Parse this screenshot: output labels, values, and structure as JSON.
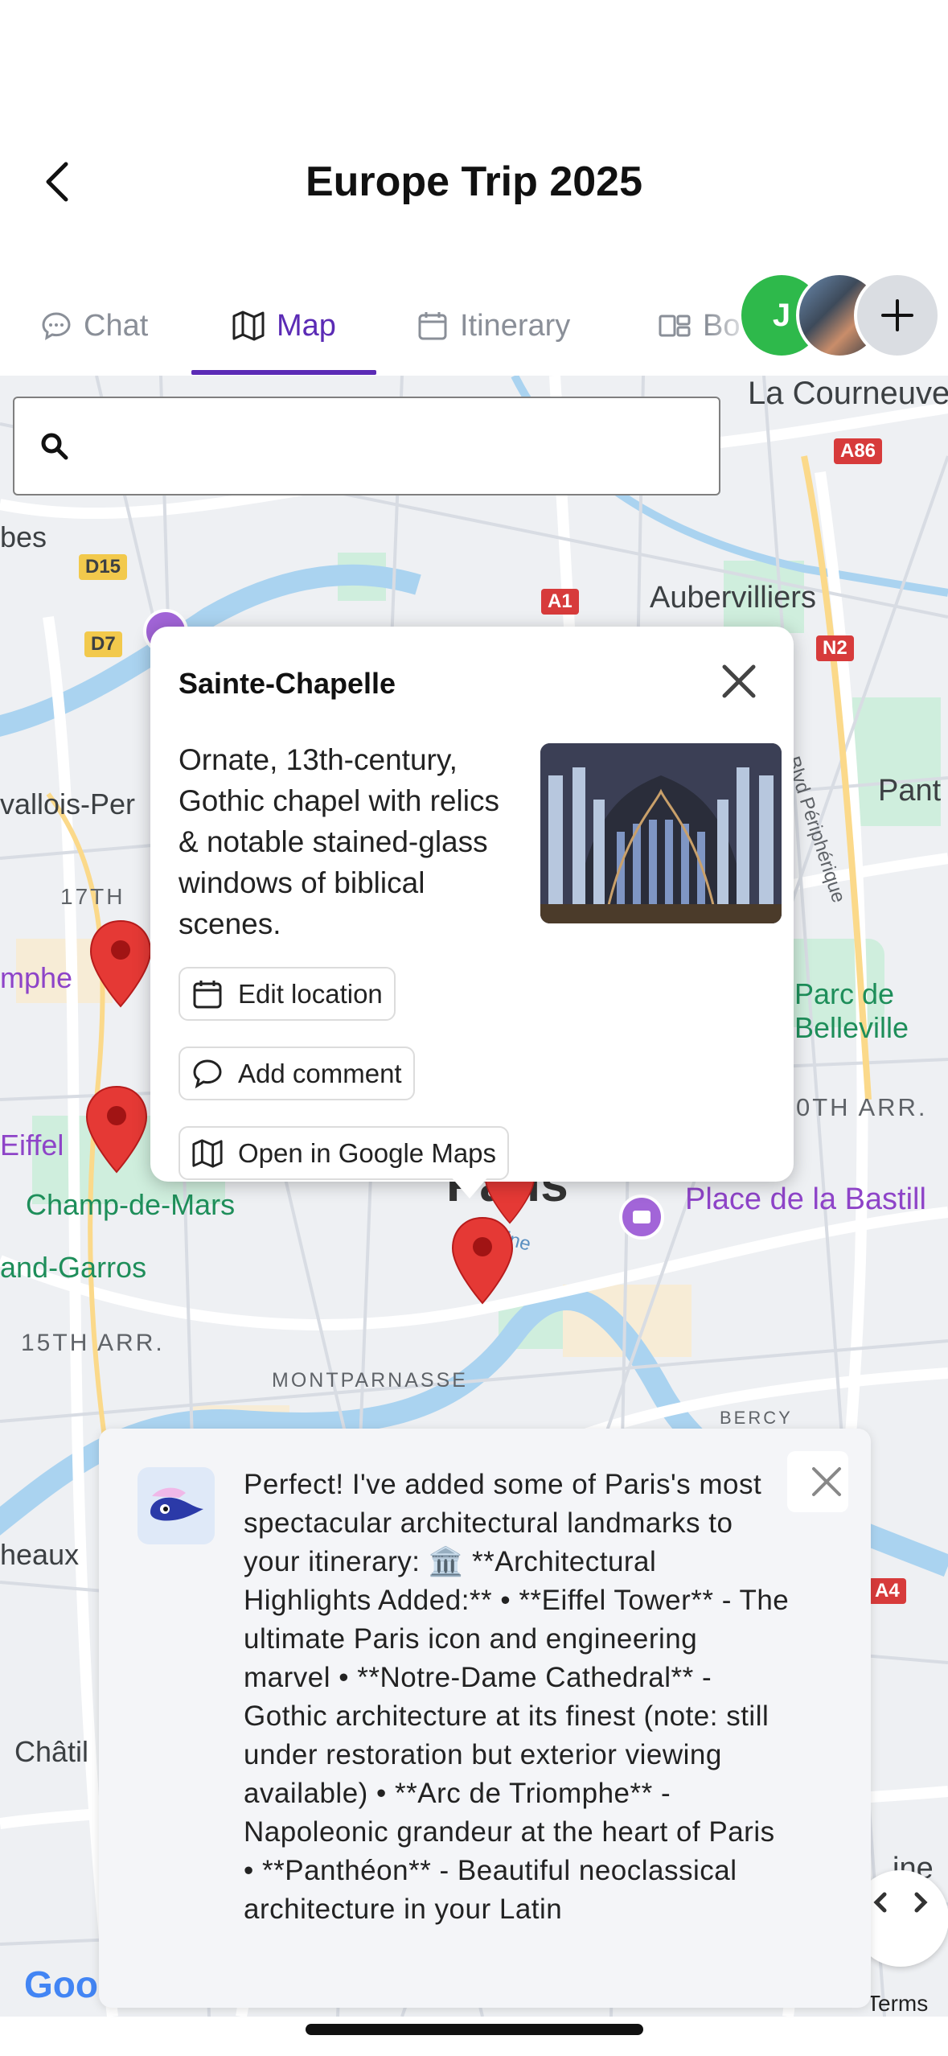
{
  "header": {
    "title": "Europe Trip 2025"
  },
  "tabs": [
    {
      "label": "Chat",
      "icon": "chat-bubble-icon"
    },
    {
      "label": "Map",
      "icon": "map-icon",
      "active": true
    },
    {
      "label": "Itinerary",
      "icon": "calendar-icon"
    },
    {
      "label": "Bo",
      "icon": "board-icon"
    }
  ],
  "avatars": [
    {
      "initial": "J",
      "color": "#2eb94b"
    },
    {
      "type": "photo"
    },
    {
      "type": "add",
      "icon": "plus-icon"
    }
  ],
  "search": {
    "placeholder": ""
  },
  "map_labels": {
    "la_courneuve": "La Courneuve",
    "aubervilliers": "Aubervilliers",
    "bes": "bes",
    "vallois": "vallois-Per",
    "arr17": "17TH",
    "mphe": "mphe",
    "eiffel": "Eiffel",
    "champ": "Champ-de-Mars",
    "garros": "and-Garros",
    "arr15": "15TH ARR.",
    "montparnasse": "MONTPARNASSE",
    "paris": "Paris",
    "bastille": "Place de la Bastill",
    "parc": "Parc de Belleville",
    "arr20": "0TH ARR.",
    "pant": "Pant",
    "bercy": "BERCY",
    "heaux": "heaux",
    "chatil": "Châtil",
    "boulevard": "Blvd Périphérique",
    "seine": "ine",
    "ine2": "ine"
  },
  "road_badges": {
    "a86": "A86",
    "a1": "A1",
    "n2": "N2",
    "d15": "D15",
    "d7": "D7",
    "a4": "A4"
  },
  "popup": {
    "title": "Sainte-Chapelle",
    "description": "Ornate, 13th-century, Gothic chapel with relics & notable stained-glass windows of biblical scenes.",
    "buttons": {
      "edit": "Edit location",
      "comment": "Add comment",
      "open": "Open in Google Maps"
    }
  },
  "chat": {
    "message": "Perfect! I've added some of Paris's most spectacular architectural landmarks to your itinerary: 🏛️ **Architectural Highlights Added:** • **Eiffel Tower** - The ultimate Paris icon and engineering marvel • **Notre-Dame Cathedral** - Gothic architecture at its finest (note: still under restoration but exterior viewing available) • **Arc de Triomphe** - Napoleonic grandeur at the heart of Paris • **Panthéon** - Beautiful neoclassical architecture in your Latin"
  },
  "footer": {
    "terms": "Terms",
    "google": "Goo"
  },
  "colors": {
    "accent": "#5b2bb5",
    "pin": "#e53935",
    "green_avatar": "#2eb94b"
  }
}
